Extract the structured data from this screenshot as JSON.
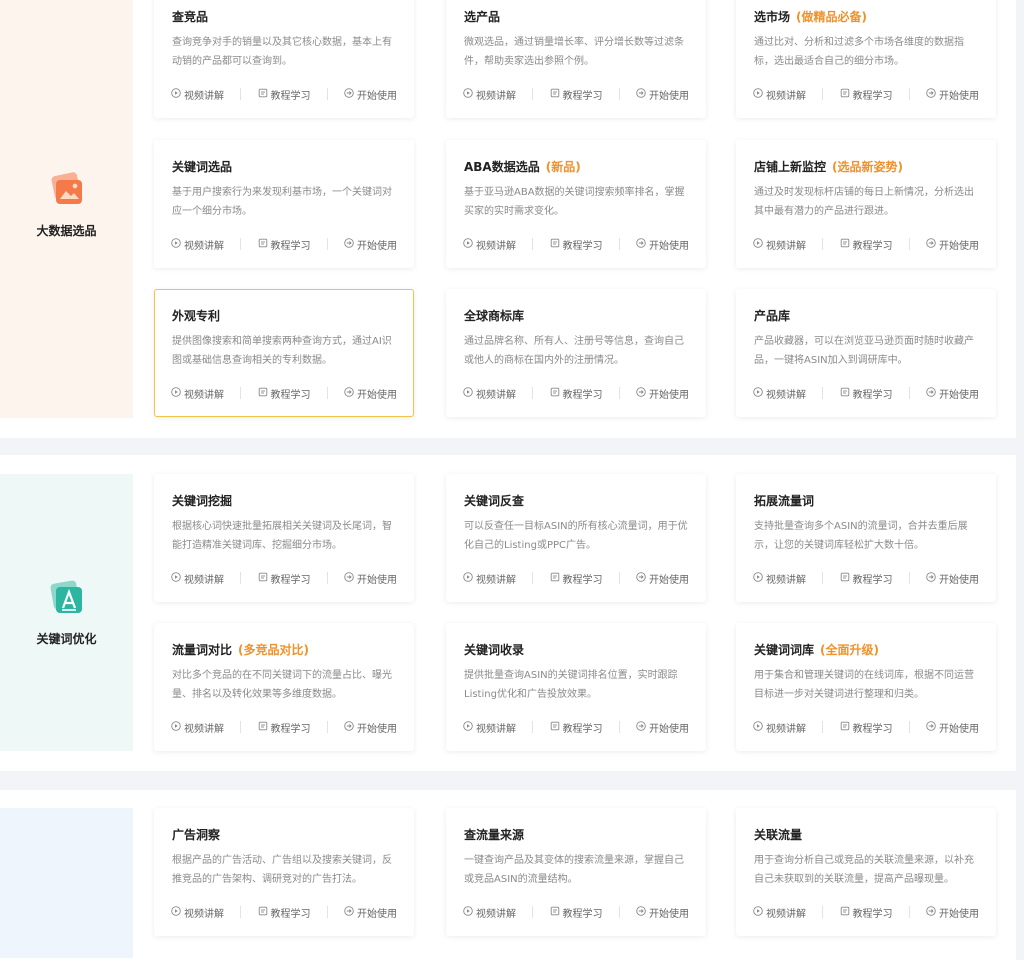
{
  "actions": {
    "video": "视频讲解",
    "tutorial": "教程学习",
    "start": "开始使用"
  },
  "sections": [
    {
      "label": "大数据选品",
      "icon": "image-stack-icon",
      "color_bg": "#fdf4ee",
      "color_icon": "#f47a4a",
      "cards": [
        {
          "title": "查竞品",
          "tag": "",
          "desc": "查询竞争对手的销量以及其它核心数据，基本上有动销的产品都可以查询到。"
        },
        {
          "title": "选产品",
          "tag": "",
          "desc": "微观选品，通过销量增长率、评分增长数等过滤条件，帮助卖家选出参照个例。"
        },
        {
          "title": "选市场",
          "tag": "(做精品必备)",
          "desc": "通过比对、分析和过滤多个市场各维度的数据指标，选出最适合自己的细分市场。"
        },
        {
          "title": "关键词选品",
          "tag": "",
          "desc": "基于用户搜索行为来发现利基市场，一个关键词对应一个细分市场。"
        },
        {
          "title": "ABA数据选品",
          "tag": "(新品)",
          "desc": "基于亚马逊ABA数据的关键词搜索频率排名，掌握买家的实时需求变化。"
        },
        {
          "title": "店铺上新监控",
          "tag": "(选品新姿势)",
          "desc": "通过及时发现标杆店铺的每日上新情况，分析选出其中最有潜力的产品进行跟进。"
        },
        {
          "title": "外观专利",
          "tag": "",
          "desc": "提供图像搜索和简单搜索两种查询方式，通过AI识图或基础信息查询相关的专利数据。"
        },
        {
          "title": "全球商标库",
          "tag": "",
          "desc": "通过品牌名称、所有人、注册号等信息，查询自己或他人的商标在国内外的注册情况。"
        },
        {
          "title": "产品库",
          "tag": "",
          "desc": "产品收藏器，可以在浏览亚马逊页面时随时收藏产品，一键将ASIN加入到调研库中。"
        }
      ]
    },
    {
      "label": "关键词优化",
      "icon": "keyword-a-icon",
      "color_bg": "#eef8f7",
      "color_icon": "#2cb5a0",
      "cards": [
        {
          "title": "关键词挖掘",
          "tag": "",
          "desc": "根据核心词快速批量拓展相关关键词及长尾词，智能打造精准关键词库、挖掘细分市场。"
        },
        {
          "title": "关键词反查",
          "tag": "",
          "desc": "可以反查任一目标ASIN的所有核心流量词，用于优化自己的Listing或PPC广告。"
        },
        {
          "title": "拓展流量词",
          "tag": "",
          "desc": "支持批量查询多个ASIN的流量词，合并去重后展示，让您的关键词库轻松扩大数十倍。"
        },
        {
          "title": "流量词对比",
          "tag": "(多竞品对比)",
          "desc": "对比多个竞品的在不同关键词下的流量占比、曝光量、排名以及转化效果等多维度数据。"
        },
        {
          "title": "关键词收录",
          "tag": "",
          "desc": "提供批量查询ASIN的关键词排名位置，实时跟踪Listing优化和广告投放效果。"
        },
        {
          "title": "关键词词库",
          "tag": "(全面升级)",
          "desc": "用于集合和管理关键词的在线词库，根据不同运营目标进一步对关键词进行整理和归类。"
        }
      ]
    },
    {
      "label": "",
      "icon": "",
      "color_bg": "#eef5fc",
      "color_icon": "#4a8ef0",
      "cards": [
        {
          "title": "广告洞察",
          "tag": "",
          "desc": "根据产品的广告活动、广告组以及搜索关键词，反推竞品的广告架构、调研竞对的广告打法。"
        },
        {
          "title": "查流量来源",
          "tag": "",
          "desc": "一键查询产品及其变体的搜索流量来源，掌握自己或竞品ASIN的流量结构。"
        },
        {
          "title": "关联流量",
          "tag": "",
          "desc": "用于查询分析自己或竞品的关联流量来源，以补充自己未获取到的关联流量，提高产品曝现量。"
        }
      ]
    }
  ]
}
